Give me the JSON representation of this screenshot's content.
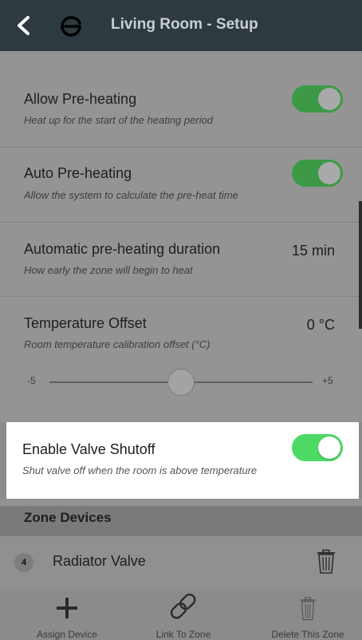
{
  "header": {
    "title": "Living Room - Setup",
    "back_icon": "chevron-left-icon",
    "logo_icon": "brand-logo-icon"
  },
  "settings": [
    {
      "label": "Allow Pre-heating",
      "description": "Heat up for the start of the heating period",
      "toggle_on": true
    },
    {
      "label": "Auto Pre-heating",
      "description": "Allow the system to calculate the pre-heat time",
      "toggle_on": true
    },
    {
      "label": "Automatic pre-heating duration",
      "description": "How early the zone will begin to heat",
      "value": "15 min"
    },
    {
      "label": "Temperature Offset",
      "description": "Room temperature calibration offset (°C)",
      "value": "0 °C",
      "slider": {
        "min_label": "-5",
        "max_label": "+5",
        "min": -5,
        "max": 5,
        "value": 0
      }
    }
  ],
  "valve_shutoff": {
    "label": "Enable Valve Shutoff",
    "description": "Shut valve off when the room is above temperature",
    "toggle_on": true
  },
  "zone_devices": {
    "title": "Zone Devices",
    "items": [
      {
        "badge": "4",
        "name": "Radiator Valve"
      }
    ]
  },
  "bottom_bar": {
    "assign": "Assign Device",
    "link": "Link To Zone",
    "delete": "Delete This Zone"
  },
  "colors": {
    "header_bg": "#2d3a40",
    "toggle_dimmed": "#3c9a47",
    "toggle_active": "#4cd964"
  }
}
